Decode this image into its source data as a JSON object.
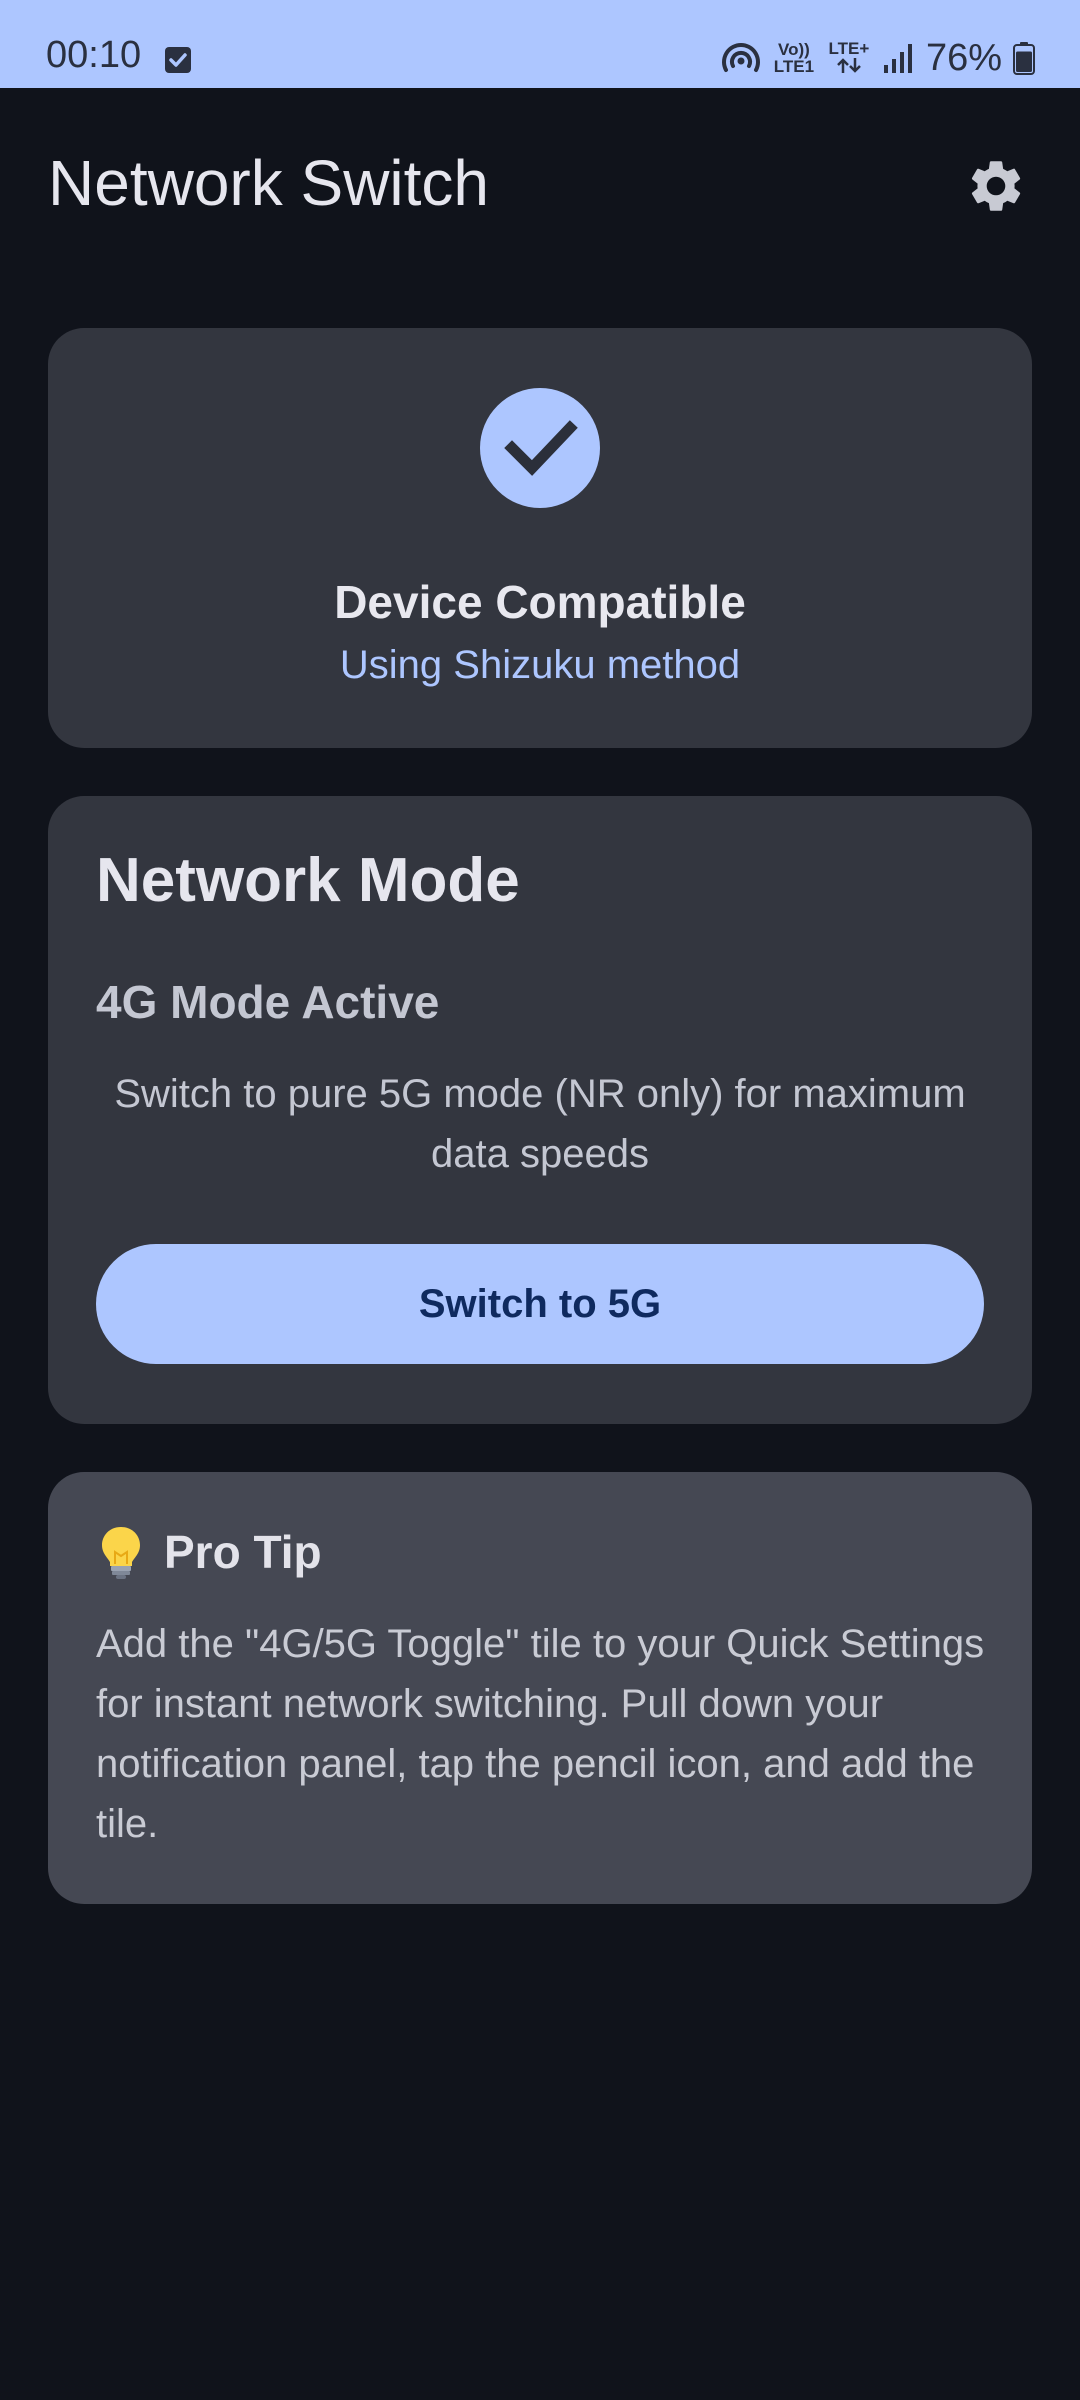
{
  "status_bar": {
    "time": "00:10",
    "volte_top": "Vo))",
    "volte_bottom": "LTE1",
    "lte_label": "LTE+",
    "battery_percent": "76%",
    "battery_level_fraction": 0.76
  },
  "app_bar": {
    "title": "Network Switch",
    "settings_icon": "gear-icon"
  },
  "compatibility_card": {
    "icon": "check-icon",
    "title": "Device Compatible",
    "subtitle": "Using Shizuku method"
  },
  "network_card": {
    "title": "Network Mode",
    "mode_status": "4G Mode Active",
    "description": "Switch to pure 5G mode (NR only) for maximum data speeds",
    "button_label": "Switch to 5G"
  },
  "tip_card": {
    "icon": "lightbulb-icon",
    "title": "Pro Tip",
    "body": "Add the \"4G/5G Toggle\" tile to your Quick Settings for instant network switching. Pull down your notification panel, tap the pencil icon, and add the tile."
  },
  "colors": {
    "background": "#10131b",
    "card": "#33363f",
    "tip_card": "#454853",
    "accent": "#adc6ff",
    "button_text": "#0f2a5f"
  }
}
